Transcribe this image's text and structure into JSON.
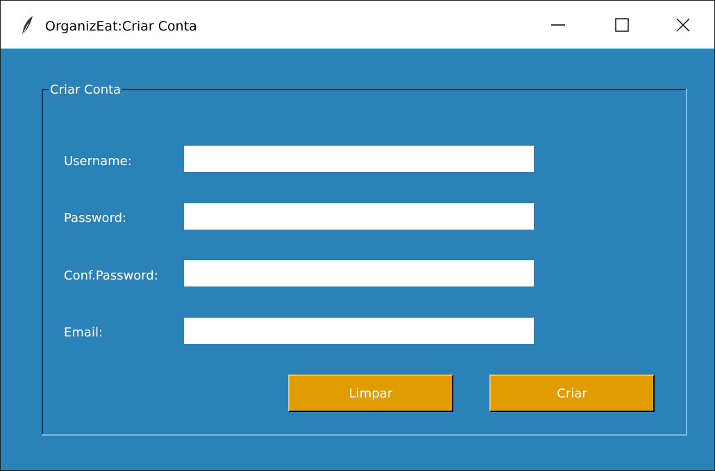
{
  "window": {
    "title": "OrganizEat:Criar Conta",
    "icon": "feather-icon",
    "controls": [
      "minimize-icon",
      "maximize-icon",
      "close-icon"
    ]
  },
  "form": {
    "frame_label": "Criar Conta",
    "fields": [
      {
        "label": "Username:",
        "value": ""
      },
      {
        "label": "Password:",
        "value": ""
      },
      {
        "label": "Conf.Password:",
        "value": ""
      },
      {
        "label": "Email:",
        "value": ""
      }
    ],
    "buttons": {
      "clear_label": "Limpar",
      "create_label": "Criar"
    }
  },
  "colors": {
    "background": "#2a82b8",
    "button": "#e09c00",
    "text": "#ffffff"
  }
}
